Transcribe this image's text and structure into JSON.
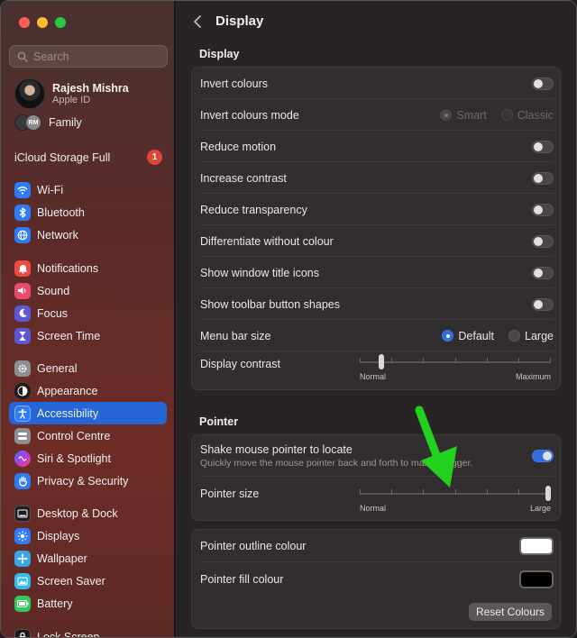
{
  "sidebar": {
    "search_placeholder": "Search",
    "profile": {
      "name": "Rajesh Mishra",
      "subtitle": "Apple ID"
    },
    "family": {
      "initials": "RM",
      "label": "Family"
    },
    "icloud": {
      "label": "iCloud Storage Full",
      "badge": "1"
    },
    "items": [
      {
        "label": "Wi-Fi",
        "icon": "wifi-icon",
        "color": "#2f7bf6"
      },
      {
        "label": "Bluetooth",
        "icon": "bluetooth-icon",
        "color": "#2f7bf6"
      },
      {
        "label": "Network",
        "icon": "globe-icon",
        "color": "#2f7bf6"
      },
      {
        "label": "Notifications",
        "icon": "bell-icon",
        "color": "#ec4a45"
      },
      {
        "label": "Sound",
        "icon": "speaker-icon",
        "color": "#ec4a6a"
      },
      {
        "label": "Focus",
        "icon": "moon-icon",
        "color": "#5d57d8"
      },
      {
        "label": "Screen Time",
        "icon": "hourglass-icon",
        "color": "#5d57d8"
      },
      {
        "label": "General",
        "icon": "gear-icon",
        "color": "#8e8e93"
      },
      {
        "label": "Appearance",
        "icon": "appearance-icon",
        "color": "#1c1c1e"
      },
      {
        "label": "Accessibility",
        "icon": "accessibility-icon",
        "color": "#2f7bf6"
      },
      {
        "label": "Control Centre",
        "icon": "control-centre-icon",
        "color": "#8e8e93"
      },
      {
        "label": "Siri & Spotlight",
        "icon": "siri-icon",
        "color": "#7a3be0"
      },
      {
        "label": "Privacy & Security",
        "icon": "hand-icon",
        "color": "#2f7bf6"
      },
      {
        "label": "Desktop & Dock",
        "icon": "dock-icon",
        "color": "#1c1c1e"
      },
      {
        "label": "Displays",
        "icon": "sun-icon",
        "color": "#2f7bf6"
      },
      {
        "label": "Wallpaper",
        "icon": "wallpaper-icon",
        "color": "#37a6e6"
      },
      {
        "label": "Screen Saver",
        "icon": "screensaver-icon",
        "color": "#37b8e6"
      },
      {
        "label": "Battery",
        "icon": "battery-icon",
        "color": "#34c759"
      },
      {
        "label": "Lock Screen",
        "icon": "lock-icon",
        "color": "#1c1c1e"
      }
    ],
    "selected": "Accessibility"
  },
  "header": {
    "title": "Display"
  },
  "display": {
    "section_title": "Display",
    "rows": [
      {
        "label": "Invert colours",
        "type": "toggle",
        "on": false
      },
      {
        "label": "Invert colours mode",
        "type": "radio",
        "options": [
          "Smart",
          "Classic"
        ],
        "selected": "Smart",
        "disabled": true
      },
      {
        "label": "Reduce motion",
        "type": "toggle",
        "on": false
      },
      {
        "label": "Increase contrast",
        "type": "toggle",
        "on": false
      },
      {
        "label": "Reduce transparency",
        "type": "toggle",
        "on": false
      },
      {
        "label": "Differentiate without colour",
        "type": "toggle",
        "on": false
      },
      {
        "label": "Show window title icons",
        "type": "toggle",
        "on": false
      },
      {
        "label": "Show toolbar button shapes",
        "type": "toggle",
        "on": false
      },
      {
        "label": "Menu bar size",
        "type": "radio",
        "options": [
          "Default",
          "Large"
        ],
        "selected": "Default",
        "disabled": false
      },
      {
        "label": "Display contrast",
        "type": "slider",
        "min_label": "Normal",
        "max_label": "Maximum",
        "value": 0.1
      }
    ]
  },
  "pointer": {
    "section_title": "Pointer",
    "shake": {
      "label": "Shake mouse pointer to locate",
      "description": "Quickly move the mouse pointer back and forth to make it bigger.",
      "on": true
    },
    "size": {
      "label": "Pointer size",
      "min_label": "Normal",
      "max_label": "Large",
      "value": 1.0
    },
    "outline": {
      "label": "Pointer outline colour",
      "color": "#ffffff"
    },
    "fill": {
      "label": "Pointer fill colour",
      "color": "#000000"
    },
    "reset_label": "Reset Colours"
  },
  "annotation": {
    "arrow_color": "#22d11e"
  }
}
